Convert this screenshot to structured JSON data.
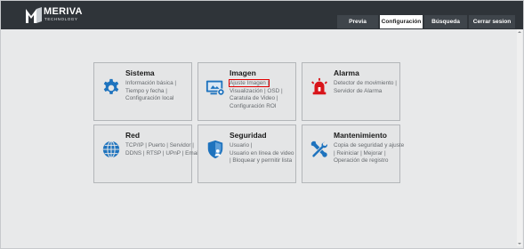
{
  "brand": {
    "name": "MERIVA",
    "subtitle": "TECHNOLOGY"
  },
  "tabs": [
    {
      "label": "Previa",
      "active": false
    },
    {
      "label": "Configuración",
      "active": true
    },
    {
      "label": "Búsqueda",
      "active": false
    },
    {
      "label": "Cerrar sesion",
      "active": false
    }
  ],
  "cards": [
    {
      "title": "Sistema",
      "icon": "gear-icon",
      "links": [
        "Información básica |",
        "Tiempo y fecha |",
        "Configuración local"
      ]
    },
    {
      "title": "Imagen",
      "icon": "image-settings-icon",
      "links": [
        "Ajuste Imagen |",
        "Visualización | OSD |",
        "Caratula de Video |",
        "Configuración ROI"
      ],
      "highlighted_link": "Ajuste Imagen |"
    },
    {
      "title": "Alarma",
      "icon": "alarm-siren-icon",
      "links": [
        "Detector de movimiento |",
        "Servidor de Alarma"
      ]
    },
    {
      "title": "Red",
      "icon": "globe-icon",
      "links": [
        "TCP/IP | Puerto | Servidor |",
        "DDNS | RTSP | UPnP | Email"
      ]
    },
    {
      "title": "Seguridad",
      "icon": "shield-user-icon",
      "links": [
        "Usuario |",
        "Usuario en línea de video",
        "| Bloquear y permitir lista"
      ]
    },
    {
      "title": "Mantenimiento",
      "icon": "tools-icon",
      "links": [
        "Copia de seguridad y ajuste",
        "| Reiniciar | Mejorar |",
        "Operación de registro"
      ]
    }
  ],
  "colors": {
    "header_bg": "#2f3439",
    "page_bg": "#e8e9ea",
    "icon_blue": "#1e73be",
    "alarm_red": "#d8141a",
    "highlight": "#e00000"
  }
}
